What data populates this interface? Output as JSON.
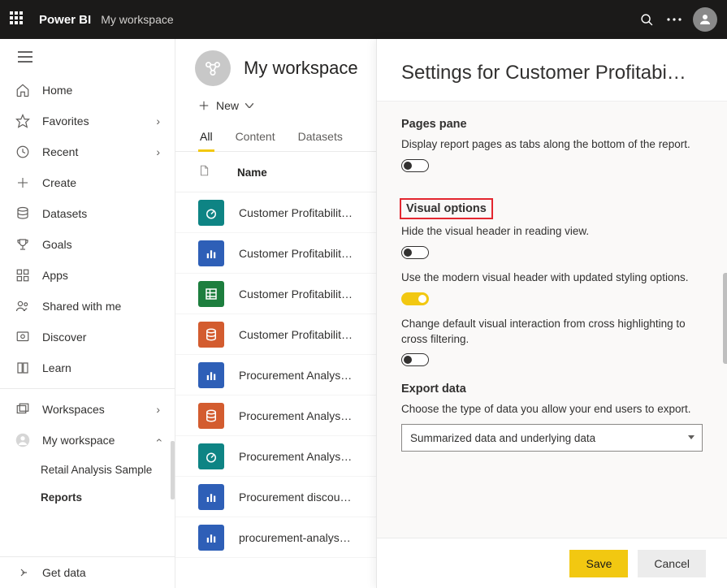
{
  "topbar": {
    "brand": "Power BI",
    "workspace": "My workspace"
  },
  "nav": {
    "items": [
      {
        "label": "Home"
      },
      {
        "label": "Favorites",
        "chevron": true
      },
      {
        "label": "Recent",
        "chevron": true
      },
      {
        "label": "Create"
      },
      {
        "label": "Datasets"
      },
      {
        "label": "Goals"
      },
      {
        "label": "Apps"
      },
      {
        "label": "Shared with me"
      },
      {
        "label": "Discover"
      },
      {
        "label": "Learn"
      }
    ],
    "workspaces_label": "Workspaces",
    "myworkspace_label": "My workspace",
    "subs": [
      {
        "label": "Retail Analysis Sample"
      },
      {
        "label": "Reports",
        "bold": true
      }
    ],
    "getdata_label": "Get data"
  },
  "content": {
    "ws_title": "My workspace",
    "new_label": "New",
    "tabs": [
      {
        "label": "All",
        "active": true
      },
      {
        "label": "Content"
      },
      {
        "label": "Datasets"
      }
    ],
    "col_name": "Name",
    "rows": [
      {
        "name": "Customer Profitabilit…",
        "tile": "teal",
        "kind": "dashboard"
      },
      {
        "name": "Customer Profitabilit…",
        "tile": "blue",
        "kind": "report"
      },
      {
        "name": "Customer Profitabilit…",
        "tile": "green",
        "kind": "workbook"
      },
      {
        "name": "Customer Profitabilit…",
        "tile": "orange",
        "kind": "dataset"
      },
      {
        "name": "Procurement Analys…",
        "tile": "blue",
        "kind": "report"
      },
      {
        "name": "Procurement Analys…",
        "tile": "orange",
        "kind": "dataset"
      },
      {
        "name": "Procurement Analys…",
        "tile": "teal",
        "kind": "dashboard"
      },
      {
        "name": "Procurement discou…",
        "tile": "blue",
        "kind": "report"
      },
      {
        "name": "procurement-analys…",
        "tile": "blue",
        "kind": "report"
      }
    ]
  },
  "panel": {
    "title": "Settings for Customer Profitabi…",
    "pages_pane": {
      "title": "Pages pane",
      "desc": "Display report pages as tabs along the bottom of the report.",
      "on": false
    },
    "visual_options": {
      "title": "Visual options",
      "opt1": {
        "desc": "Hide the visual header in reading view.",
        "on": false
      },
      "opt2": {
        "desc": "Use the modern visual header with updated styling options.",
        "on": true
      },
      "opt3": {
        "desc": "Change default visual interaction from cross highlighting to cross filtering.",
        "on": false
      }
    },
    "export": {
      "title": "Export data",
      "desc": "Choose the type of data you allow your end users to export.",
      "selected": "Summarized data and underlying data"
    },
    "save_label": "Save",
    "cancel_label": "Cancel"
  }
}
